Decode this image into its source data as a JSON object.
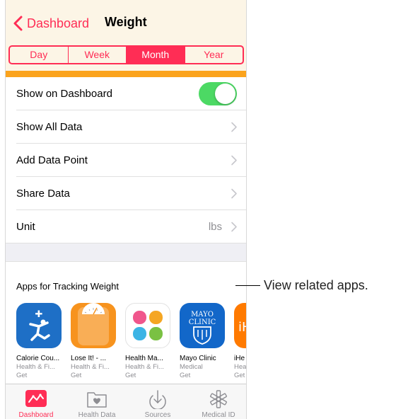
{
  "navbar": {
    "back_label": "Dashboard",
    "title": "Weight",
    "segments": [
      "Day",
      "Week",
      "Month",
      "Year"
    ],
    "selected_segment": "Month"
  },
  "settings": {
    "rows": [
      {
        "label": "Show on Dashboard",
        "control": "toggle",
        "on": true
      },
      {
        "label": "Show All Data",
        "control": "chevron"
      },
      {
        "label": "Add Data Point",
        "control": "chevron"
      },
      {
        "label": "Share Data",
        "control": "chevron"
      },
      {
        "label": "Unit",
        "value": "lbs",
        "control": "chevron"
      }
    ]
  },
  "apps": {
    "header": "Apps for Tracking Weight",
    "items": [
      {
        "name": "Calorie Cou...",
        "category": "Health & Fi...",
        "action": "Get",
        "icon": "under-armour-app-icon",
        "color": "#1e6fc6"
      },
      {
        "name": "Lose It! - ...",
        "category": "Health & Fi...",
        "action": "Get",
        "icon": "scale-app-icon",
        "color": "#f7931e"
      },
      {
        "name": "Health Ma...",
        "category": "Health & Fi...",
        "action": "Get",
        "icon": "petal-app-icon",
        "color": "#ffffff"
      },
      {
        "name": "Mayo Clinic",
        "category": "Medical",
        "action": "Get",
        "icon": "mayo-clinic-app-icon",
        "color": "#1267c9",
        "icon_text": "MAYO CLINIC"
      },
      {
        "name": "iHe",
        "category": "Hea",
        "action": "Get",
        "icon": "partial-app-icon",
        "color": "#ff7a00",
        "icon_text": "iH"
      }
    ]
  },
  "tabbar": {
    "tabs": [
      {
        "label": "Dashboard",
        "icon": "dashboard-icon",
        "active": true
      },
      {
        "label": "Health Data",
        "icon": "health-data-icon",
        "active": false
      },
      {
        "label": "Sources",
        "icon": "sources-icon",
        "active": false
      },
      {
        "label": "Medical ID",
        "icon": "medical-id-icon",
        "active": false
      }
    ]
  },
  "callout": {
    "text": "View related apps."
  },
  "colors": {
    "accent": "#ff2d55",
    "toggle_on": "#4cd964",
    "chart_strip": "#fba31c",
    "nav_bg": "#fcf5e6"
  }
}
